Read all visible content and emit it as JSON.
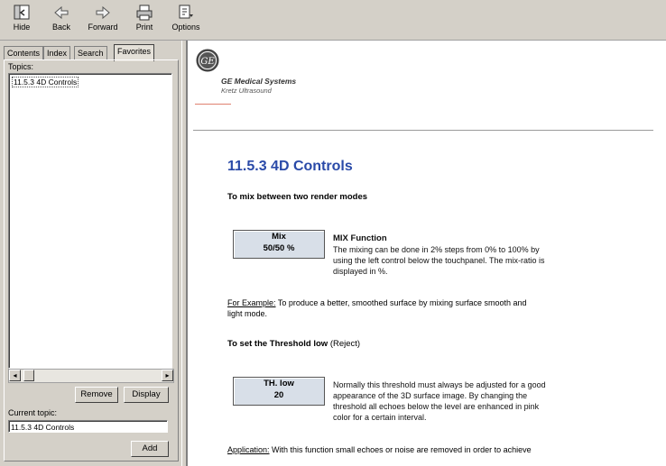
{
  "toolbar": {
    "hide": "Hide",
    "back": "Back",
    "forward": "Forward",
    "print": "Print",
    "options": "Options"
  },
  "tabs": {
    "contents": "Contents",
    "index": "Index",
    "search": "Search",
    "favorites": "Favorites"
  },
  "left": {
    "topics_label": "Topics:",
    "topics": [
      "11.5.3 4D Controls"
    ],
    "remove": "Remove",
    "display": "Display",
    "current_label": "Current topic:",
    "current_value": "11.5.3 4D Controls",
    "add": "Add"
  },
  "doc": {
    "company": "GE Medical Systems",
    "division": "Kretz Ultrasound",
    "title": "11.5.3 4D Controls",
    "section1": "To mix between two render modes",
    "mix_key_line1": "Mix",
    "mix_key_line2": "50/50 %",
    "mix_heading": "MIX Function",
    "mix_desc_1": "The mixing can be done in 2% steps from 0% to 100% by",
    "mix_desc_2": "using the left control below the touchpanel. The mix-ratio is",
    "mix_desc_3": "displayed in %.",
    "example_label": "For Example:",
    "example_text_1": " To produce a better, smoothed surface by mixing surface smooth and",
    "example_text_2": "light mode.",
    "section2_bold": "To set the Threshold low",
    "section2_normal": " (Reject)",
    "th_key_line1": "TH. low",
    "th_key_line2": "20",
    "th_desc_1": "Normally this threshold must always be adjusted for a good",
    "th_desc_2": "appearance of the 3D surface image. By changing the",
    "th_desc_3": "threshold all echoes below the level are enhanced in pink",
    "th_desc_4": "color for a certain interval.",
    "application_label": "Application:",
    "application_text": " With this function small echoes or noise are removed in order to achieve"
  },
  "colors": {
    "title": "#2a4aa8",
    "key_bg": "#d8dfe8",
    "chrome": "#d4d0c8"
  }
}
